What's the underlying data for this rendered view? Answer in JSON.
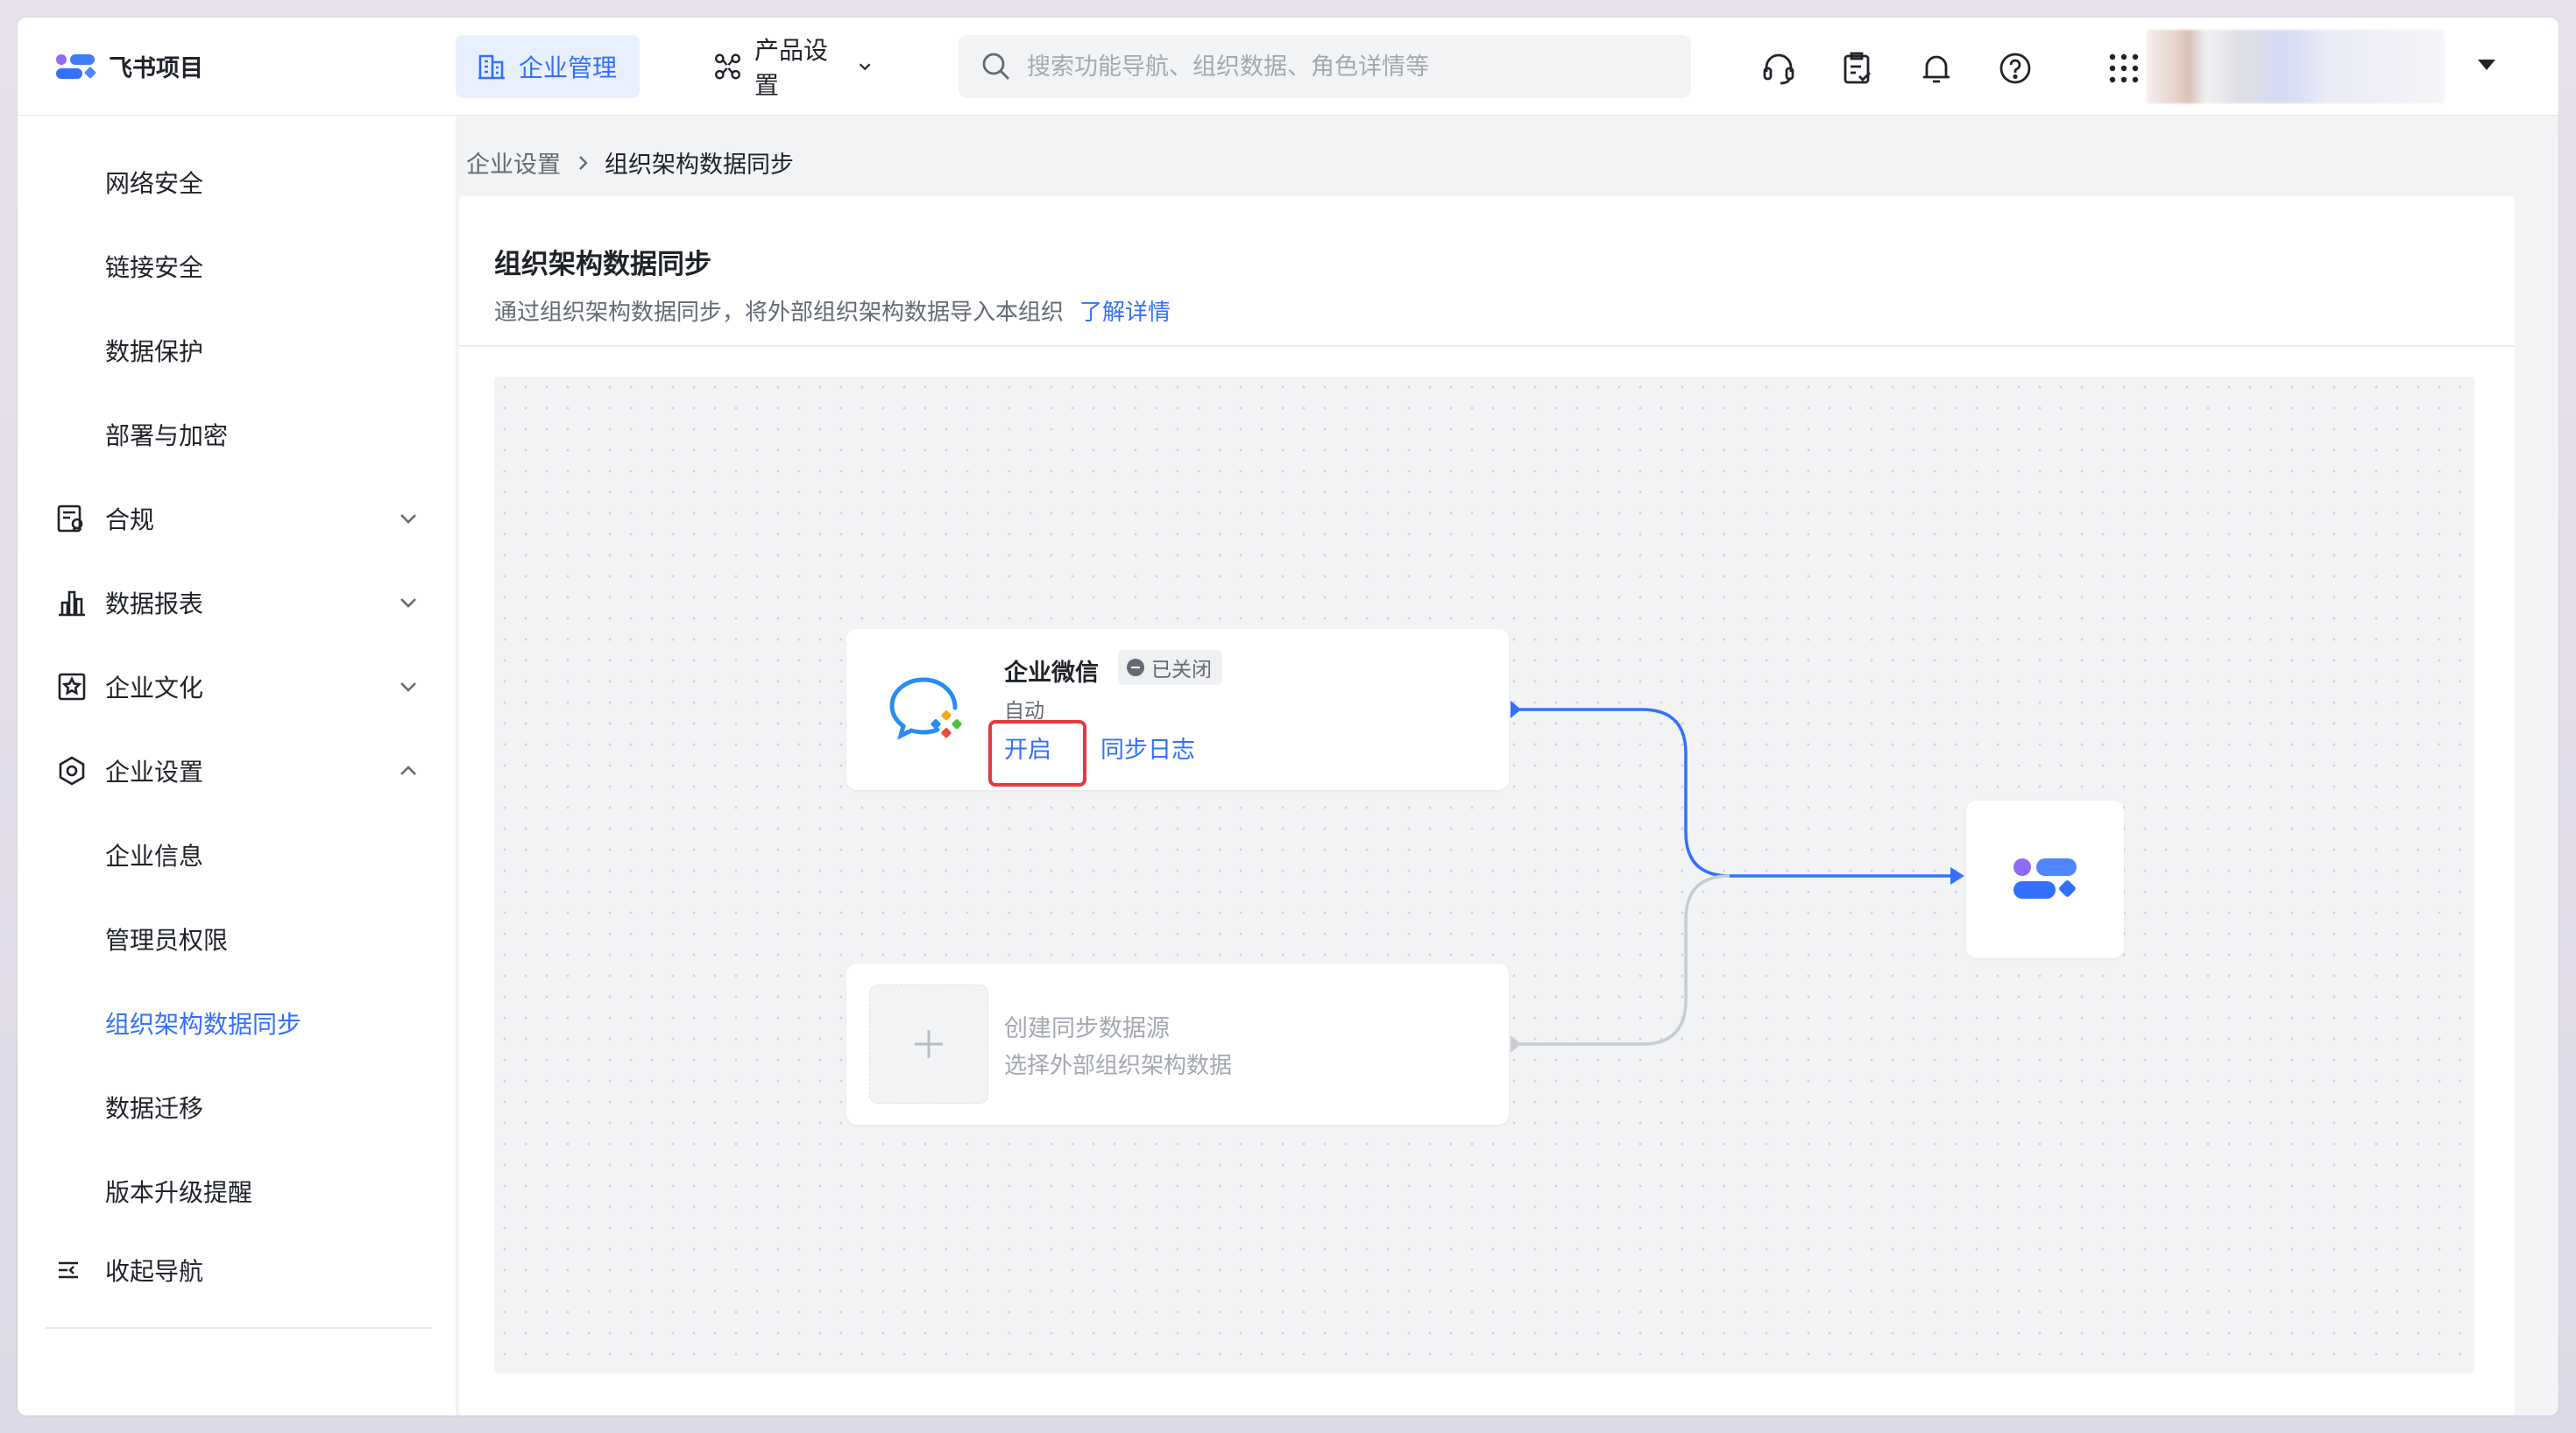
{
  "app": {
    "name": "飞书项目"
  },
  "colors": {
    "accent": "#3370ff",
    "highlight": "#e8383d",
    "text": "#1f2329",
    "muted": "#646a73",
    "disabled": "#a4a8b0"
  },
  "header": {
    "nav_active": "企业管理",
    "nav_product": "产品设置",
    "search_placeholder": "搜索功能导航、组织数据、角色详情等",
    "icons": [
      "headset-icon",
      "clipboard-check-icon",
      "bell-icon",
      "help-icon",
      "apps-grid-icon"
    ]
  },
  "sidebar": {
    "items": [
      {
        "label": "网络安全",
        "type": "sub"
      },
      {
        "label": "链接安全",
        "type": "sub"
      },
      {
        "label": "数据保护",
        "type": "sub"
      },
      {
        "label": "部署与加密",
        "type": "sub"
      },
      {
        "label": "合规",
        "type": "group",
        "icon": "compliance-icon",
        "expanded": false
      },
      {
        "label": "数据报表",
        "type": "group",
        "icon": "bar-chart-icon",
        "expanded": false
      },
      {
        "label": "企业文化",
        "type": "group",
        "icon": "culture-icon",
        "expanded": false
      },
      {
        "label": "企业设置",
        "type": "group",
        "icon": "settings-hexagon-icon",
        "expanded": true
      },
      {
        "label": "企业信息",
        "type": "sub"
      },
      {
        "label": "管理员权限",
        "type": "sub"
      },
      {
        "label": "组织架构数据同步",
        "type": "sub",
        "active": true
      },
      {
        "label": "数据迁移",
        "type": "sub"
      },
      {
        "label": "版本升级提醒",
        "type": "sub"
      }
    ],
    "collapse_label": "收起导航"
  },
  "breadcrumb": {
    "parent": "企业设置",
    "current": "组织架构数据同步"
  },
  "page": {
    "title": "组织架构数据同步",
    "description": "通过组织架构数据同步，将外部组织架构数据导入本组织",
    "learn_more": "了解详情"
  },
  "sources": {
    "wecom": {
      "name": "企业微信",
      "status": "已关闭",
      "mode": "自动",
      "enable_label": "开启",
      "sync_log_label": "同步日志"
    },
    "add": {
      "title": "创建同步数据源",
      "description": "选择外部组织架构数据"
    }
  }
}
